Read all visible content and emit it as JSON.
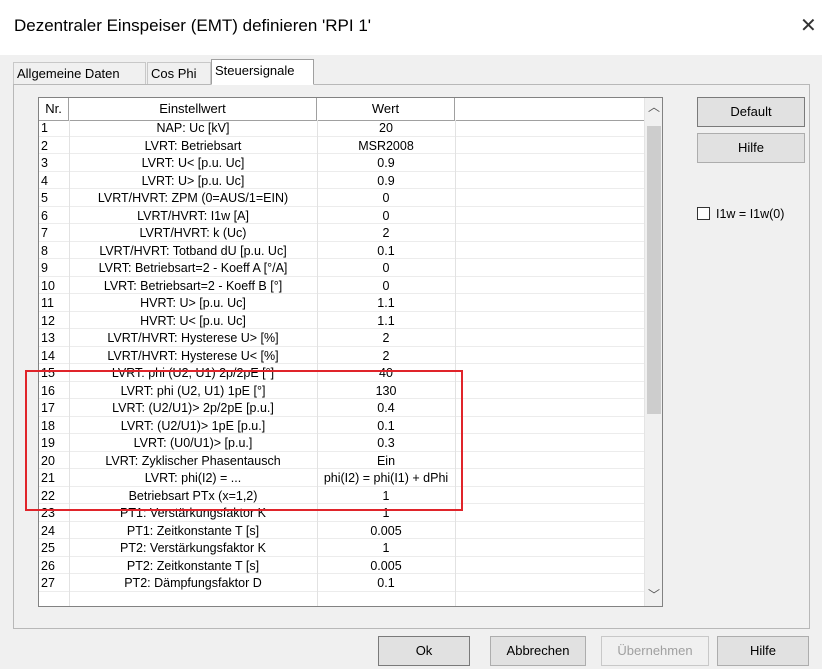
{
  "window": {
    "title": "Dezentraler Einspeiser (EMT) definieren 'RPI 1'",
    "close_glyph": "✕"
  },
  "tabs": [
    {
      "label": "Allgemeine Daten"
    },
    {
      "label": "Cos Phi"
    },
    {
      "label": "Steuersignale",
      "active": true
    }
  ],
  "table": {
    "headers": {
      "nr": "Nr.",
      "name": "Einstellwert",
      "value": "Wert"
    },
    "rows": [
      {
        "nr": "1",
        "name": "NAP: Uc [kV]",
        "value": "20"
      },
      {
        "nr": "2",
        "name": "LVRT: Betriebsart",
        "value": "MSR2008"
      },
      {
        "nr": "3",
        "name": "LVRT: U< [p.u. Uc]",
        "value": "0.9"
      },
      {
        "nr": "4",
        "name": "LVRT: U> [p.u. Uc]",
        "value": "0.9"
      },
      {
        "nr": "5",
        "name": "LVRT/HVRT: ZPM (0=AUS/1=EIN)",
        "value": "0"
      },
      {
        "nr": "6",
        "name": "LVRT/HVRT: I1w [A]",
        "value": "0"
      },
      {
        "nr": "7",
        "name": "LVRT/HVRT: k (Uc)",
        "value": "2"
      },
      {
        "nr": "8",
        "name": "LVRT/HVRT: Totband dU [p.u. Uc]",
        "value": "0.1"
      },
      {
        "nr": "9",
        "name": "LVRT: Betriebsart=2 - Koeff A [°/A]",
        "value": "0"
      },
      {
        "nr": "10",
        "name": "LVRT: Betriebsart=2 - Koeff B [°]",
        "value": "0"
      },
      {
        "nr": "11",
        "name": "HVRT: U> [p.u. Uc]",
        "value": "1.1"
      },
      {
        "nr": "12",
        "name": "HVRT: U< [p.u. Uc]",
        "value": "1.1"
      },
      {
        "nr": "13",
        "name": "LVRT/HVRT: Hysterese U> [%]",
        "value": "2"
      },
      {
        "nr": "14",
        "name": "LVRT/HVRT: Hysterese U< [%]",
        "value": "2"
      },
      {
        "nr": "15",
        "name": "LVRT: phi (U2, U1) 2p/2pE [°]",
        "value": "40"
      },
      {
        "nr": "16",
        "name": "LVRT: phi (U2, U1) 1pE [°]",
        "value": "130"
      },
      {
        "nr": "17",
        "name": "LVRT: (U2/U1)> 2p/2pE [p.u.]",
        "value": "0.4"
      },
      {
        "nr": "18",
        "name": "LVRT: (U2/U1)> 1pE [p.u.]",
        "value": "0.1"
      },
      {
        "nr": "19",
        "name": "LVRT: (U0/U1)> [p.u.]",
        "value": "0.3"
      },
      {
        "nr": "20",
        "name": "LVRT: Zyklischer Phasentausch",
        "value": "Ein"
      },
      {
        "nr": "21",
        "name": "LVRT: phi(I2) = ...",
        "value": "phi(I2) = phi(I1) + dPhi"
      },
      {
        "nr": "22",
        "name": "Betriebsart PTx (x=1,2)",
        "value": "1"
      },
      {
        "nr": "23",
        "name": "PT1: Verstärkungsfaktor K",
        "value": "1"
      },
      {
        "nr": "24",
        "name": "PT1: Zeitkonstante T [s]",
        "value": "0.005"
      },
      {
        "nr": "25",
        "name": "PT2: Verstärkungsfaktor K",
        "value": "1"
      },
      {
        "nr": "26",
        "name": "PT2: Zeitkonstante T [s]",
        "value": "0.005"
      },
      {
        "nr": "27",
        "name": "PT2: Dämpfungsfaktor D",
        "value": "0.1"
      }
    ]
  },
  "side": {
    "default_label": "Default",
    "help_label": "Hilfe",
    "checkbox_label": "I1w = I1w(0)",
    "checkbox_checked": false
  },
  "footer": {
    "ok_label": "Ok",
    "cancel_label": "Abbrechen",
    "apply_label": "Übernehmen",
    "help_label": "Hilfe"
  },
  "colors": {
    "highlight": "#e0242a"
  }
}
